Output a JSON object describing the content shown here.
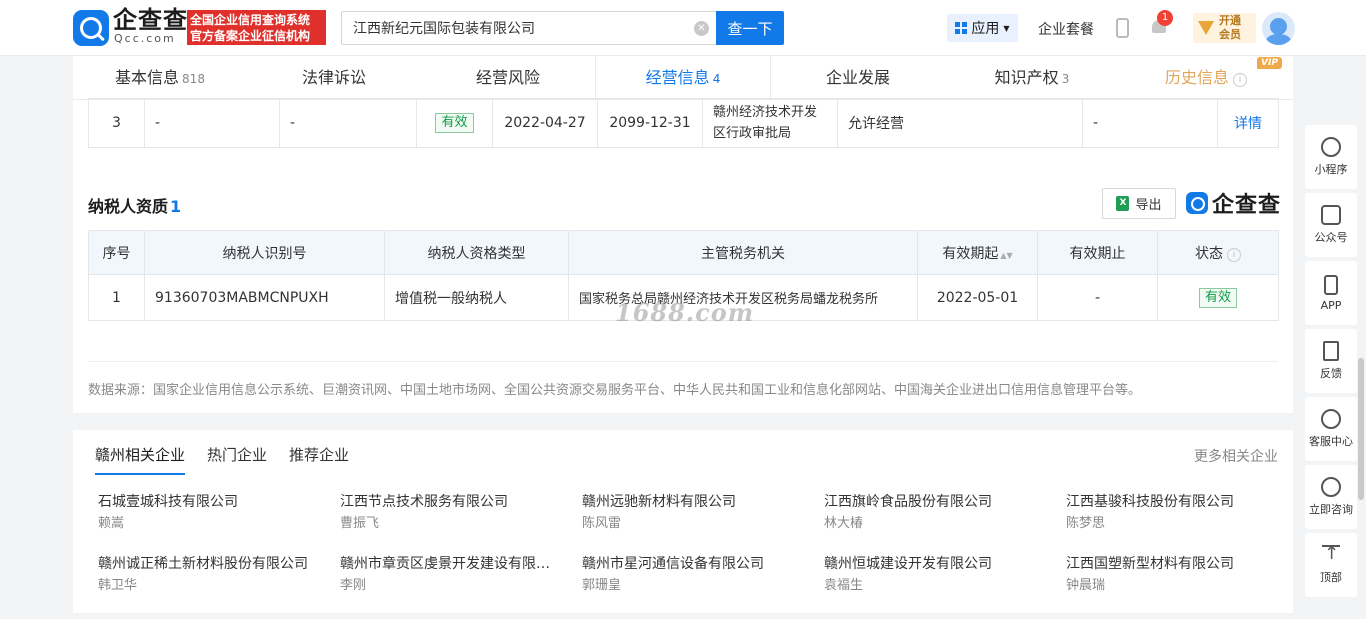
{
  "header": {
    "logo_text": "企查查",
    "logo_sub": "Qcc.com",
    "badge_line1": "全国企业信用查询系统",
    "badge_line2": "官方备案企业征信机构",
    "search_value": "江西新纪元国际包装有限公司",
    "search_button": "查一下",
    "apps_label": "应用",
    "packages_label": "企业套餐",
    "notification_count": "1",
    "vip_line1": "开通",
    "vip_line2": "会员"
  },
  "tabs": [
    {
      "label": "基本信息",
      "count": "818"
    },
    {
      "label": "法律诉讼",
      "count": ""
    },
    {
      "label": "经营风险",
      "count": ""
    },
    {
      "label": "经营信息",
      "count": "4"
    },
    {
      "label": "企业发展",
      "count": ""
    },
    {
      "label": "知识产权",
      "count": "3"
    },
    {
      "label": "历史信息",
      "count": "",
      "tag": "VIP"
    }
  ],
  "prev_row": {
    "index": "3",
    "c1": "-",
    "c2": "-",
    "status": "有效",
    "start": "2022-04-27",
    "end": "2099-12-31",
    "authority": "赣州经济技术开发区行政审批局",
    "content": "允许经营",
    "c8": "-",
    "action": "详情"
  },
  "taxpayer": {
    "title": "纳税人资质",
    "count": "1",
    "export_label": "导出",
    "brand": "企查查",
    "headers": [
      "序号",
      "纳税人识别号",
      "纳税人资格类型",
      "主管税务机关",
      "有效期起",
      "有效期止",
      "状态"
    ],
    "rows": [
      {
        "index": "1",
        "id": "91360703MABMCNPUXH",
        "type": "增值税一般纳税人",
        "authority": "国家税务总局赣州经济技术开发区税务局蟠龙税务所",
        "start": "2022-05-01",
        "end": "-",
        "status": "有效"
      }
    ]
  },
  "watermark": "1688.com",
  "source_text": "数据来源：国家企业信用信息公示系统、巨潮资讯网、中国土地市场网、全国公共资源交易服务平台、中华人民共和国工业和信息化部网站、中国海关企业进出口信用信息管理平台等。",
  "related": {
    "tabs": [
      "赣州相关企业",
      "热门企业",
      "推荐企业"
    ],
    "more": "更多相关企业",
    "companies": [
      {
        "name": "石城壹城科技有限公司",
        "person": "赖嵩"
      },
      {
        "name": "江西节点技术服务有限公司",
        "person": "曹振飞"
      },
      {
        "name": "赣州远驰新材料有限公司",
        "person": "陈风雷"
      },
      {
        "name": "江西旗岭食品股份有限公司",
        "person": "林大椿"
      },
      {
        "name": "江西基骏科技股份有限公司",
        "person": "陈梦思"
      },
      {
        "name": "赣州诚正稀土新材料股份有限公司",
        "person": "韩卫华"
      },
      {
        "name": "赣州市章贡区虔景开发建设有限公司",
        "person": "李刚"
      },
      {
        "name": "赣州市星河通信设备有限公司",
        "person": "郭珊皇"
      },
      {
        "name": "赣州恒城建设开发有限公司",
        "person": "袁福生"
      },
      {
        "name": "江西国塑新型材料有限公司",
        "person": "钟晨瑞"
      }
    ]
  },
  "sidebar": [
    {
      "label": "小程序",
      "icon": "mini-program-icon"
    },
    {
      "label": "公众号",
      "icon": "official-account-icon"
    },
    {
      "label": "APP",
      "icon": "phone-icon"
    },
    {
      "label": "反馈",
      "icon": "feedback-icon"
    },
    {
      "label": "客服中心",
      "icon": "headset-icon"
    },
    {
      "label": "立即咨询",
      "icon": "chat-icon"
    },
    {
      "label": "顶部",
      "icon": "back-to-top-icon"
    }
  ]
}
